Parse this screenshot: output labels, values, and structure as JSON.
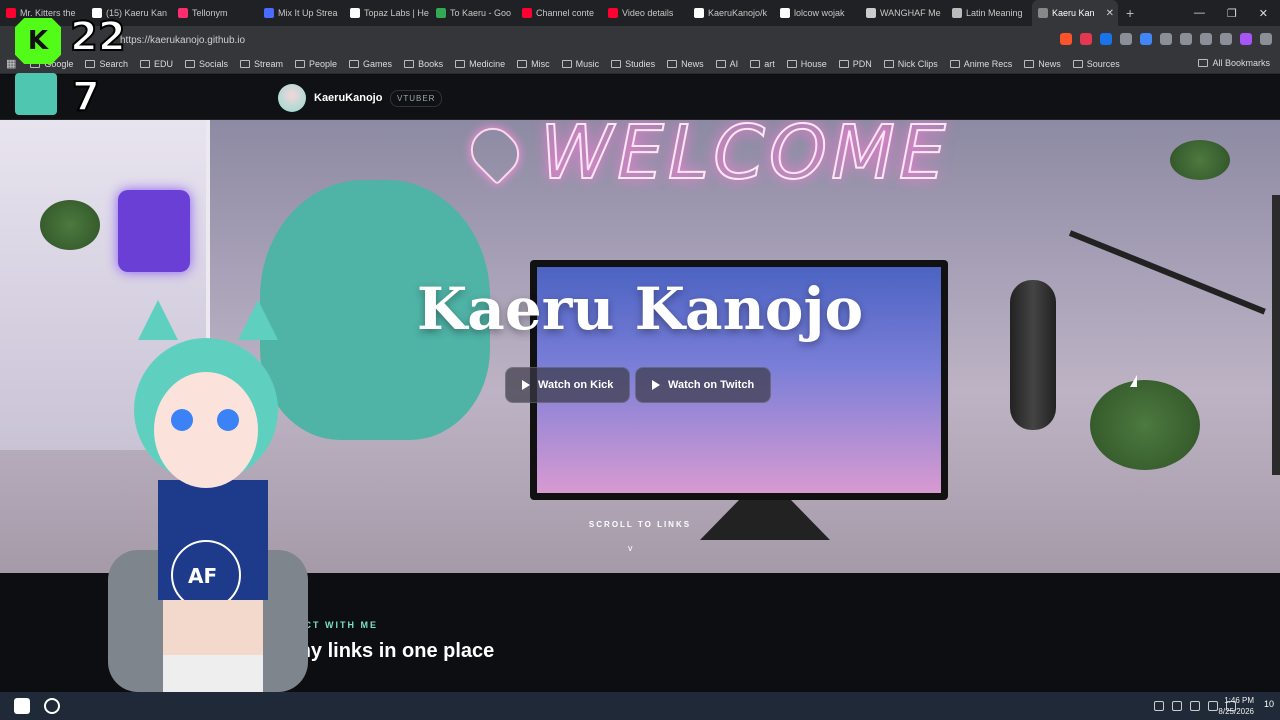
{
  "browser": {
    "tabs": [
      {
        "label": "Mr. Kitters the",
        "color": "#ff0033"
      },
      {
        "label": "(15) Kaeru Kan",
        "color": "#ffffff"
      },
      {
        "label": "Tellonym",
        "color": "#ff2d6f"
      },
      {
        "label": "Mix It Up Strea",
        "color": "#4a6bff"
      },
      {
        "label": "Topaz Labs | He",
        "color": "#ffffff"
      },
      {
        "label": "To Kaeru - Goo",
        "color": "#34a853"
      },
      {
        "label": "Channel conte",
        "color": "#ff0033"
      },
      {
        "label": "Video details",
        "color": "#ff0033"
      },
      {
        "label": "KaeruKanojo/k",
        "color": "#ffffff"
      },
      {
        "label": "lolcow wojak",
        "color": "#ffffff"
      },
      {
        "label": "WANGHAF Me",
        "color": "#cccccc"
      },
      {
        "label": "Latin Meaning",
        "color": "#bbbbbb"
      },
      {
        "label": "Kaeru Kan",
        "color": "#888888",
        "active": true
      }
    ],
    "url": "https://kaerukanojo.github.io",
    "bookmarks": [
      "Google",
      "Search",
      "EDU",
      "Socials",
      "Stream",
      "People",
      "Games",
      "Books",
      "Medicine",
      "Misc",
      "Music",
      "Studies",
      "News",
      "AI",
      "art",
      "House",
      "PDN",
      "Nick Clips",
      "Anime Recs",
      "News",
      "Sources"
    ],
    "all_bookmarks": "All Bookmarks"
  },
  "stream_overlay": {
    "kick_count": "22",
    "kick_letter": "K",
    "twitch_count": "7"
  },
  "site": {
    "brand": "KaeruKanojo",
    "badge": "VTUBER",
    "hero_title": "Kaeru Kanojo",
    "buttons": {
      "kick": "Watch on Kick",
      "twitch": "Watch on Twitch"
    },
    "scroll_hint": "SCROLL TO LINKS",
    "scroll_icon": "v",
    "section_kicker": "CONNECT WITH ME",
    "section_title": "All my links in one place"
  },
  "taskbar": {
    "time": "1:46 PM",
    "date": "8/25/2026",
    "notification_count": "10"
  },
  "colors": {
    "kick": "#53fc18",
    "twitch": "#9146ff",
    "accent": "#7be0c6"
  }
}
